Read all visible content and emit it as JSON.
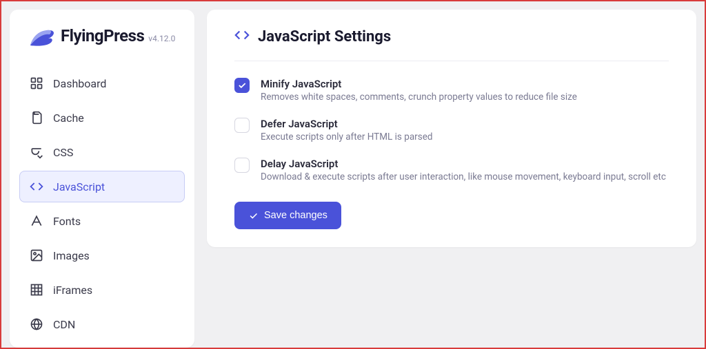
{
  "brand": {
    "name": "FlyingPress",
    "version": "v4.12.0"
  },
  "nav": {
    "dashboard": "Dashboard",
    "cache": "Cache",
    "css": "CSS",
    "javascript": "JavaScript",
    "fonts": "Fonts",
    "images": "Images",
    "iframes": "iFrames",
    "cdn": "CDN"
  },
  "page": {
    "title": "JavaScript Settings",
    "save": "Save changes"
  },
  "options": {
    "minify": {
      "title": "Minify JavaScript",
      "desc": "Removes white spaces, comments, crunch property values to reduce file size",
      "checked": true
    },
    "defer": {
      "title": "Defer JavaScript",
      "desc": "Execute scripts only after HTML is parsed",
      "checked": false
    },
    "delay": {
      "title": "Delay JavaScript",
      "desc": "Download & execute scripts after user interaction, like mouse movement, keyboard input, scroll etc",
      "checked": false
    }
  }
}
